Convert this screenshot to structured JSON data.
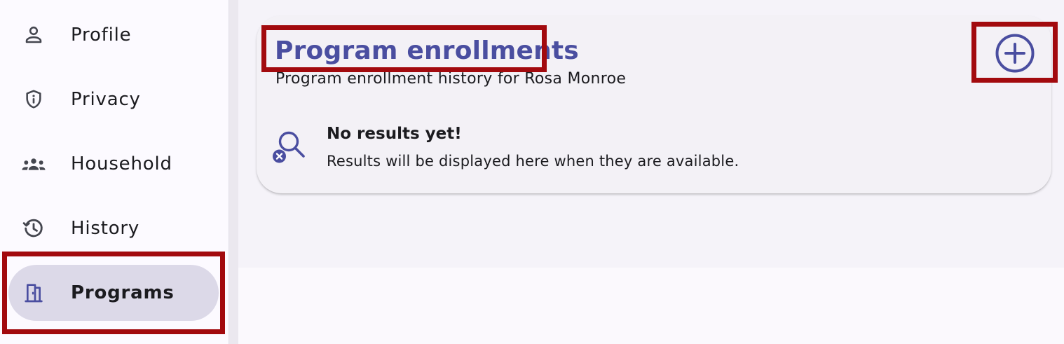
{
  "sidebar": {
    "items": [
      {
        "label": "Profile",
        "icon": "person-icon",
        "active": false
      },
      {
        "label": "Privacy",
        "icon": "shield-info-icon",
        "active": false
      },
      {
        "label": "Household",
        "icon": "group-icon",
        "active": false
      },
      {
        "label": "History",
        "icon": "history-icon",
        "active": false
      },
      {
        "label": "Programs",
        "icon": "door-icon",
        "active": true
      }
    ]
  },
  "card": {
    "title": "Program enrollments",
    "subtitle": "Program enrollment history for Rosa Monroe",
    "add_icon": "add-circle-icon",
    "empty": {
      "icon": "search-off-icon",
      "title": "No results yet!",
      "text": "Results will be displayed here when they are available."
    }
  },
  "colors": {
    "accent": "#4a4ea0",
    "active_nav_bg": "#dcd9e8",
    "highlight": "#a20a0e",
    "text": "#1b1b1f",
    "icon": "#44464f"
  }
}
